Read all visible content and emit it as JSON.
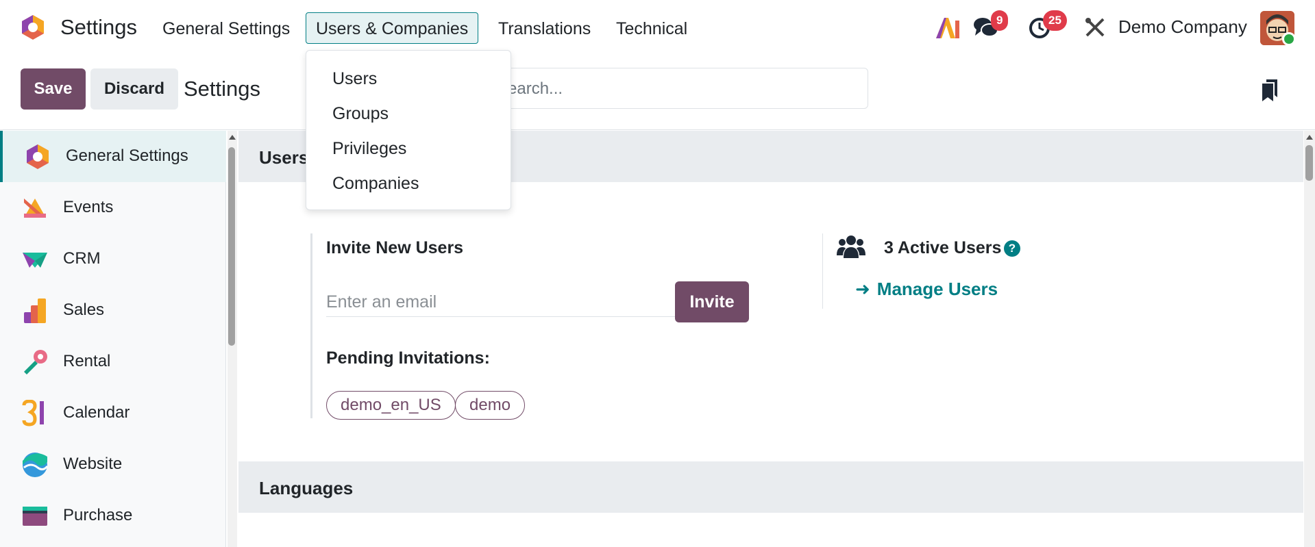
{
  "navbar": {
    "app_title": "Settings",
    "menus": [
      "General Settings",
      "Users & Companies",
      "Translations",
      "Technical"
    ],
    "active_menu": "Users & Companies",
    "messages_count": "9",
    "activities_count": "25",
    "company": "Demo Company",
    "icons": [
      "ai-icon",
      "chat-icon",
      "clock-icon",
      "tools-icon"
    ]
  },
  "dropdown": {
    "items": [
      "Users",
      "Groups",
      "Privileges",
      "Companies"
    ]
  },
  "controlbar": {
    "save_label": "Save",
    "discard_label": "Discard",
    "title": "Settings",
    "search_placeholder": "Search..."
  },
  "sidebar": {
    "items": [
      {
        "label": "General Settings",
        "icon": "settings-app-icon"
      },
      {
        "label": "Events",
        "icon": "events-app-icon"
      },
      {
        "label": "CRM",
        "icon": "crm-app-icon"
      },
      {
        "label": "Sales",
        "icon": "sales-app-icon"
      },
      {
        "label": "Rental",
        "icon": "rental-app-icon"
      },
      {
        "label": "Calendar",
        "icon": "calendar-app-icon"
      },
      {
        "label": "Website",
        "icon": "website-app-icon"
      },
      {
        "label": "Purchase",
        "icon": "purchase-app-icon"
      }
    ],
    "active_index": 0
  },
  "main": {
    "users_section_title": "Users",
    "invite_title": "Invite New Users",
    "email_placeholder": "Enter an email",
    "invite_label": "Invite",
    "pending_title": "Pending Invitations:",
    "pending_tags": [
      "demo_en_US",
      "demo"
    ],
    "active_users": "3 Active Users",
    "help_glyph": "?",
    "manage_users": "Manage Users",
    "languages_section_title": "Languages"
  },
  "colors": {
    "primary": "#714b67",
    "accent": "#017e84",
    "badge": "#e03b4a"
  }
}
